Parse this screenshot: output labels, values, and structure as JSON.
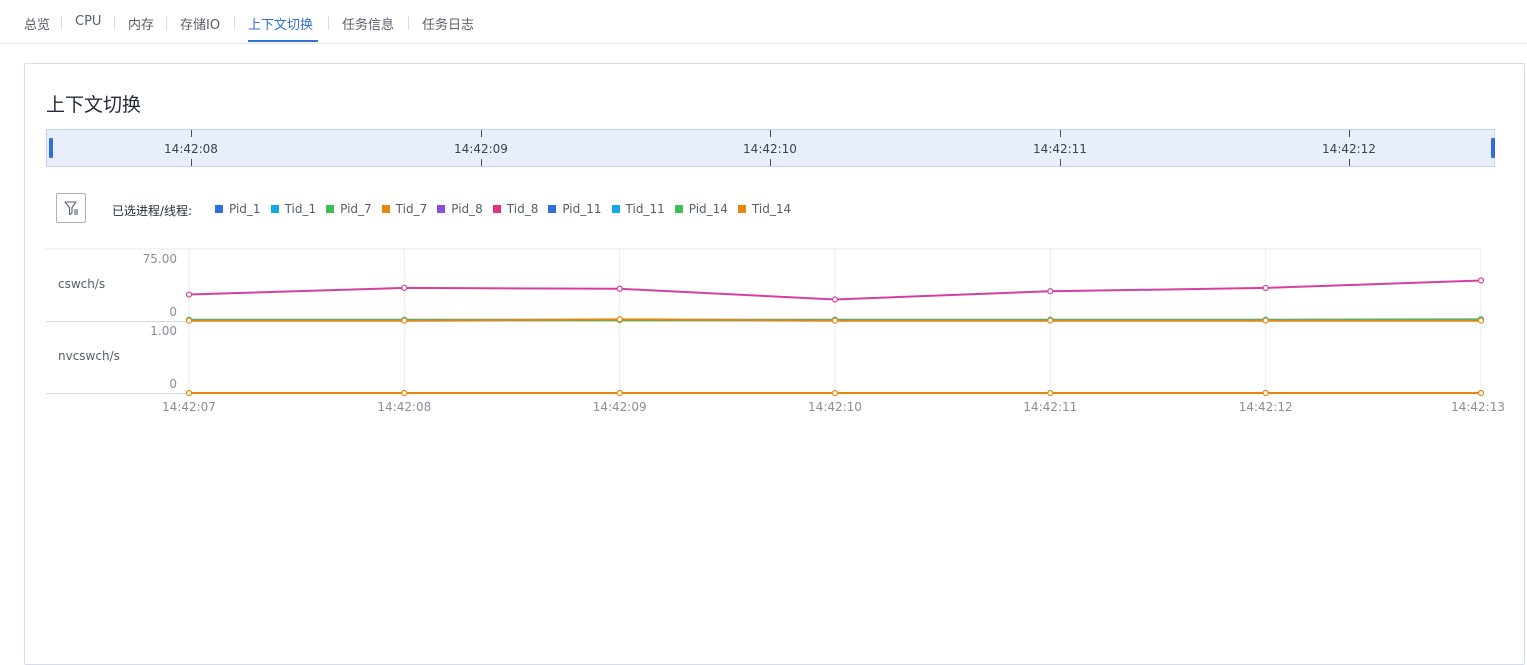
{
  "tabs": [
    {
      "label": "总览",
      "active": false
    },
    {
      "label": "CPU",
      "active": false
    },
    {
      "label": "内存",
      "active": false
    },
    {
      "label": "存储IO",
      "active": false
    },
    {
      "label": "上下文切换",
      "active": true
    },
    {
      "label": "任务信息",
      "active": false
    },
    {
      "label": "任务日志",
      "active": false
    }
  ],
  "card": {
    "title": "上下文切换"
  },
  "brush": {
    "labels": [
      "14:42:08",
      "14:42:09",
      "14:42:10",
      "14:42:11",
      "14:42:12"
    ]
  },
  "filter": {
    "icon": "filter-icon"
  },
  "legend": {
    "title": "已选进程/线程:",
    "items": [
      {
        "label": "Pid_1",
        "color": "#2f6fdb"
      },
      {
        "label": "Tid_1",
        "color": "#14a9e6"
      },
      {
        "label": "Pid_7",
        "color": "#3fbf4e"
      },
      {
        "label": "Tid_7",
        "color": "#e6860a"
      },
      {
        "label": "Pid_8",
        "color": "#8a4fe0"
      },
      {
        "label": "Tid_8",
        "color": "#e0327d"
      },
      {
        "label": "Pid_11",
        "color": "#2f6fdb"
      },
      {
        "label": "Tid_11",
        "color": "#14a9e6"
      },
      {
        "label": "Pid_14",
        "color": "#3fbf4e"
      },
      {
        "label": "Tid_14",
        "color": "#e6860a"
      }
    ]
  },
  "chart_data": [
    {
      "type": "line",
      "ylabel": "cswch/s",
      "ylim": [
        0,
        75
      ],
      "ytick_labels": [
        "75.00",
        "0"
      ],
      "x": [
        "14:42:07",
        "14:42:08",
        "14:42:09",
        "14:42:10",
        "14:42:11",
        "14:42:12",
        "14:42:13"
      ],
      "series": [
        {
          "name": "Tid_8",
          "color": "#d63fa0",
          "values": [
            32,
            40,
            39,
            26,
            36,
            40,
            49
          ]
        },
        {
          "name": "Tid_1",
          "color": "#14a9e6",
          "values": [
            1.5,
            1.5,
            1.5,
            1.5,
            1.5,
            1.5,
            2
          ]
        },
        {
          "name": "Pid_7",
          "color": "#3fbf4e",
          "values": [
            1,
            1,
            1,
            1,
            1,
            1,
            1.5
          ]
        },
        {
          "name": "Tid_7",
          "color": "#e6860a",
          "values": [
            0.5,
            0.5,
            2,
            0.5,
            0.5,
            0.5,
            0.5
          ]
        }
      ]
    },
    {
      "type": "line",
      "ylabel": "nvcswch/s",
      "ylim": [
        0,
        1
      ],
      "ytick_labels": [
        "1.00",
        "0"
      ],
      "x": [
        "14:42:07",
        "14:42:08",
        "14:42:09",
        "14:42:10",
        "14:42:11",
        "14:42:12",
        "14:42:13"
      ],
      "series": [
        {
          "name": "Tid_14",
          "color": "#e6860a",
          "values": [
            0,
            0,
            0,
            0,
            0,
            0,
            0
          ]
        }
      ]
    }
  ]
}
